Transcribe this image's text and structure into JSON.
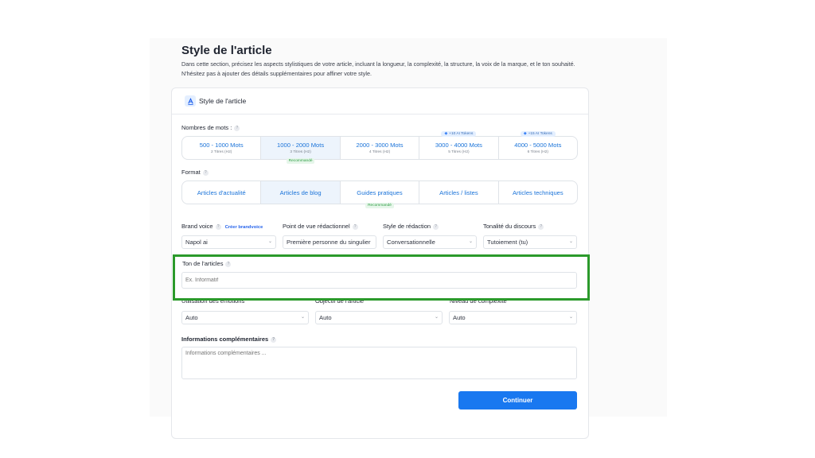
{
  "page": {
    "title": "Style de l'article",
    "description": "Dans cette section, précisez les aspects stylistiques de votre article, incluant la longueur, la complexité, la structure, la voix de la marque, et le ton souhaité. N'hésitez pas à ajouter des détails supplémentaires pour affiner votre style."
  },
  "card": {
    "title": "Style de l'article",
    "icon": "text-style-icon"
  },
  "word_count": {
    "label": "Nombres de mots :",
    "options": [
      {
        "label": "500 - 1000 Mots",
        "sub": "2 Titres (H2)"
      },
      {
        "label": "1000 - 2000 Mots",
        "sub": "3 Titres (H2)",
        "badge": "Recommandé",
        "selected": true
      },
      {
        "label": "2000 - 3000 Mots",
        "sub": "4 Titres (H2)"
      },
      {
        "label": "3000 - 4000 Mots",
        "sub": "5 Titres (H2)",
        "token": "+10 AI Tokens"
      },
      {
        "label": "4000 - 5000 Mots",
        "sub": "6 Titres (H2)",
        "token": "+15 AI Tokens"
      }
    ]
  },
  "format": {
    "label": "Format",
    "options": [
      {
        "label": "Articles d'actualité"
      },
      {
        "label": "Articles de blog",
        "selected": true
      },
      {
        "label": "Guides pratiques",
        "badge": "Recommandé"
      },
      {
        "label": "Articles / listes"
      },
      {
        "label": "Articles techniques"
      }
    ]
  },
  "brand_voice": {
    "label": "Brand voice",
    "link": "Créer brandvoice",
    "value": "Napol ai"
  },
  "point_of_view": {
    "label": "Point de vue rédactionnel",
    "value": "Première personne du singulier"
  },
  "writing_style": {
    "label": "Style de rédaction",
    "value": "Conversationnelle"
  },
  "tone_discourse": {
    "label": "Tonalité du discours",
    "value": "Tutoiement (tu)"
  },
  "article_tone": {
    "label": "Ton de l'articles",
    "placeholder": "Ex. Informatif"
  },
  "emotions": {
    "label": "Utilisation des émotions",
    "value": "Auto"
  },
  "objective": {
    "label": "Objectif de l'article",
    "value": "Auto"
  },
  "complexity": {
    "label": "Niveau de complexité",
    "value": "Auto"
  },
  "extra_info": {
    "label": "Informations complémentaires",
    "placeholder": "Informations complémentaires ..."
  },
  "continue_button": {
    "label": "Continuer"
  },
  "colors": {
    "accent": "#1978f0",
    "highlight": "#2b9a2b",
    "recommended": "#2f9e44"
  }
}
